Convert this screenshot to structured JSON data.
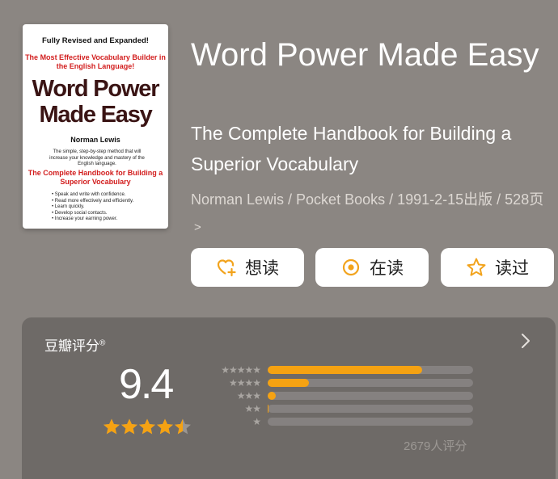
{
  "cover": {
    "line1": "Fully Revised and Expanded!",
    "line2": "The Most Effective Vocabulary Builder in the English Language!",
    "title": "Word Power Made Easy",
    "author": "Norman Lewis",
    "blurb": "The simple, step-by-step method that will increase your knowledge and mastery of the English language.",
    "subtitle": "The Complete Handbook for Building a Superior Vocabulary",
    "bullets": [
      "Speak and write with confidence.",
      "Read more effectively and efficiently.",
      "Learn quickly.",
      "Develop social contacts.",
      "Increase your earning power."
    ]
  },
  "book": {
    "title": "Word Power Made Easy",
    "subtitle": "The Complete Handbook for Building a Superior Vocabulary",
    "meta": "Norman Lewis / Pocket Books / 1991-2-15出版 / 528页",
    "meta_chevron": ">"
  },
  "actions": {
    "want": "想读",
    "reading": "在读",
    "read": "读过"
  },
  "rating": {
    "label": "豆瓣评分",
    "mark": "®",
    "score": "9.4",
    "count_text": "2679人评分",
    "stars_value": 4.5,
    "distribution": [
      {
        "stars": 5,
        "fraction": 0.75
      },
      {
        "stars": 4,
        "fraction": 0.2
      },
      {
        "stars": 3,
        "fraction": 0.04
      },
      {
        "stars": 2,
        "fraction": 0.005
      },
      {
        "stars": 1,
        "fraction": 0.0
      }
    ]
  },
  "colors": {
    "accent": "#f5a212",
    "background": "#8b8682",
    "card": "#6e6a67"
  }
}
